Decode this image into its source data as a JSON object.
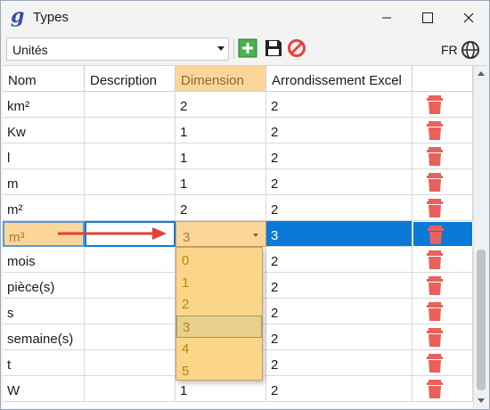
{
  "window": {
    "title": "Types",
    "app_icon": "g"
  },
  "toolbar": {
    "unit_selected": "Unités",
    "language": "FR"
  },
  "table": {
    "columns": [
      "Nom",
      "Description",
      "Dimension",
      "Arrondissement Excel"
    ],
    "rows": [
      {
        "nom": "km²",
        "description": "",
        "dimension": "2",
        "arrondi": "2"
      },
      {
        "nom": "Kw",
        "description": "",
        "dimension": "1",
        "arrondi": "2"
      },
      {
        "nom": "l",
        "description": "",
        "dimension": "1",
        "arrondi": "2"
      },
      {
        "nom": "m",
        "description": "",
        "dimension": "1",
        "arrondi": "2"
      },
      {
        "nom": "m²",
        "description": "",
        "dimension": "2",
        "arrondi": "2"
      },
      {
        "nom": "m³",
        "description": "",
        "dimension": "3",
        "arrondi": "3"
      },
      {
        "nom": "mois",
        "description": "",
        "dimension": "",
        "arrondi": "2"
      },
      {
        "nom": "pièce(s)",
        "description": "",
        "dimension": "",
        "arrondi": "2"
      },
      {
        "nom": "s",
        "description": "",
        "dimension": "",
        "arrondi": "2"
      },
      {
        "nom": "semaine(s)",
        "description": "",
        "dimension": "",
        "arrondi": "2"
      },
      {
        "nom": "t",
        "description": "",
        "dimension": "",
        "arrondi": "2"
      },
      {
        "nom": "W",
        "description": "",
        "dimension": "1",
        "arrondi": "2"
      }
    ]
  },
  "dimension_dropdown": {
    "selected": "3",
    "options": [
      "0",
      "1",
      "2",
      "3",
      "4",
      "5"
    ]
  },
  "colors": {
    "accent_header": "#fbd69a",
    "selection": "#0a7ad8",
    "dropdown_bg": "#fbd58a",
    "delete_red": "#e8615a",
    "add_green": "#4caf50",
    "arrow_red": "#e0403a"
  }
}
